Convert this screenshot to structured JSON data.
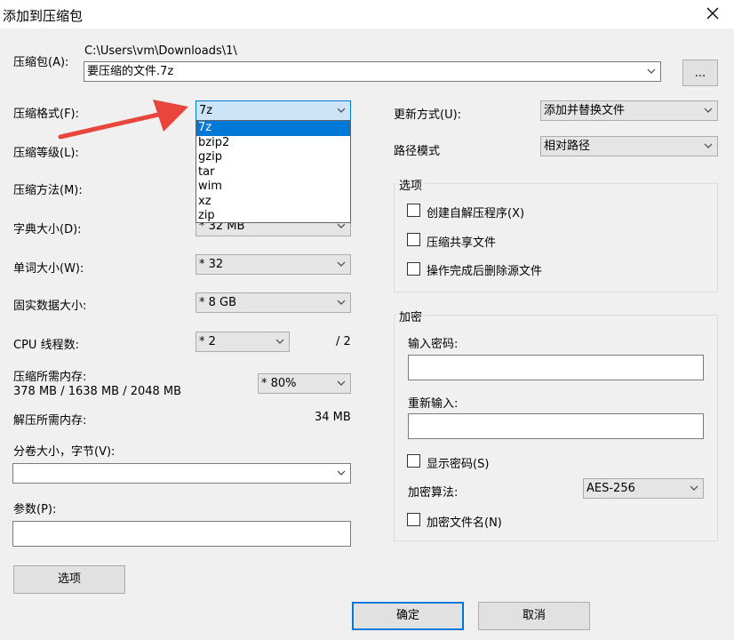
{
  "window": {
    "title": "添加到压缩包"
  },
  "archive": {
    "label": "压缩包(A):",
    "path": "C:\\Users\\vm\\Downloads\\1\\",
    "filename": "要压缩的文件.7z",
    "browse_label": "..."
  },
  "left": {
    "format_label": "压缩格式(F):",
    "format_value": "7z",
    "level_label": "压缩等级(L):",
    "method_label": "压缩方法(M):",
    "dict_label": "字典大小(D):",
    "dict_value": "* 32 MB",
    "word_label": "单词大小(W):",
    "word_value": "* 32",
    "solid_label": "固实数据大小:",
    "solid_value": "* 8 GB",
    "cpu_label": "CPU 线程数:",
    "cpu_value": "* 2",
    "cpu_total": "/ 2",
    "mem_label": "压缩所需内存:",
    "mem_value": "378 MB / 1638 MB / 2048 MB",
    "mem_percent": "* 80%",
    "decomp_label": "解压所需内存:",
    "decomp_value": "34 MB",
    "volume_label": "分卷大小，字节(V):",
    "volume_value": "",
    "params_label": "参数(P):",
    "params_value": "",
    "options_button": "选项"
  },
  "format_dropdown": {
    "options": [
      "7z",
      "bzip2",
      "gzip",
      "tar",
      "wim",
      "xz",
      "zip"
    ],
    "selected_index": 0
  },
  "right": {
    "update_label": "更新方式(U):",
    "update_value": "添加并替换文件",
    "path_label": "路径模式",
    "path_value": "相对路径",
    "options_group": "选项",
    "sfx_label": "创建自解压程序(X)",
    "shared_label": "压缩共享文件",
    "delete_label": "操作完成后删除源文件",
    "encrypt_group": "加密",
    "password_label": "输入密码:",
    "reenter_label": "重新输入:",
    "show_password_label": "显示密码(S)",
    "method_label": "加密算法:",
    "method_value": "AES-256",
    "encrypt_names_label": "加密文件名(N)"
  },
  "buttons": {
    "ok": "确定",
    "cancel": "取消"
  },
  "colors": {
    "accent": "#0078d7",
    "arrow": "#e8453c"
  }
}
